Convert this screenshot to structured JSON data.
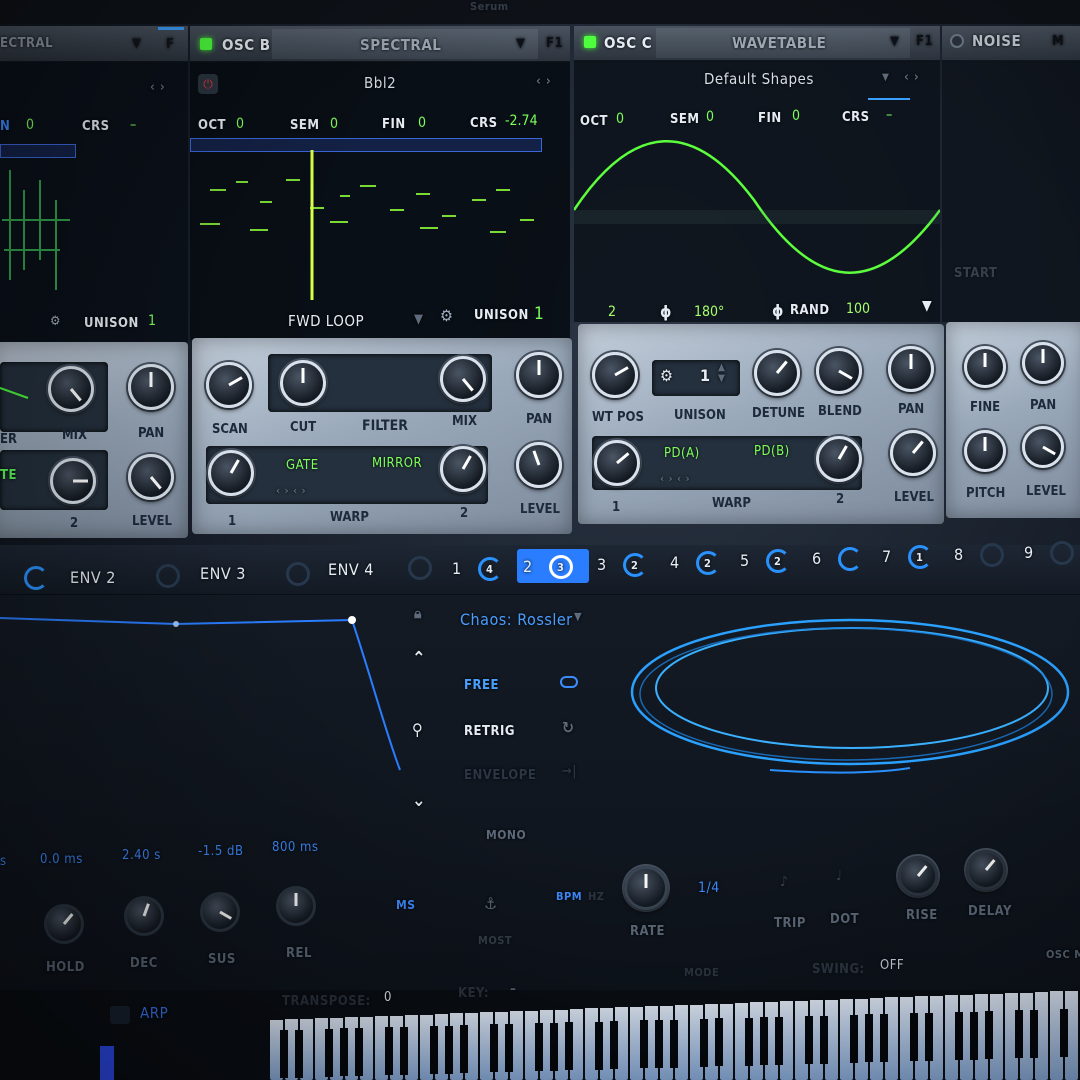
{
  "top_header": {
    "partial_title": "Serum",
    "sliver_right": "OSC"
  },
  "osc_a": {
    "type": "SPECTRAL",
    "fx_label": "F",
    "fin_label_partial": "N",
    "fin_value": "0",
    "crs_label": "CRS",
    "crs_value": "–",
    "unison_label": "UNISON",
    "unison_value": "1",
    "mix_label": "MIX",
    "pan_label": "PAN",
    "level_label": "LEVEL",
    "filter_label_partial": "ER",
    "warp_value": "2",
    "warp_mode_partial": "TE"
  },
  "osc_b": {
    "label": "OSC B",
    "type": "SPECTRAL",
    "fx_label": "F1",
    "preset": "Bbl2",
    "oct_label": "OCT",
    "oct_value": "0",
    "sem_label": "SEM",
    "sem_value": "0",
    "fin_label": "FIN",
    "fin_value": "0",
    "crs_label": "CRS",
    "crs_value": "-2.74",
    "loop_mode": "FWD LOOP",
    "unison_label": "UNISON",
    "unison_value": "1",
    "scan_label": "SCAN",
    "cut_label": "CUT",
    "filter_label": "FILTER",
    "mix_label": "MIX",
    "pan_label": "PAN",
    "level_label": "LEVEL",
    "warp_a": "GATE",
    "warp_b": "MIRROR",
    "warp_label": "WARP",
    "warp_min": "1",
    "warp_max": "2"
  },
  "osc_c": {
    "label": "OSC C",
    "type": "WAVETABLE",
    "fx_label": "F1",
    "preset": "Default Shapes",
    "oct_label": "OCT",
    "oct_value": "0",
    "sem_label": "SEM",
    "sem_value": "0",
    "fin_label": "FIN",
    "fin_value": "0",
    "crs_label": "CRS",
    "crs_value": "–",
    "unison_count": "2",
    "phase_value": "180°",
    "rand_label": "RAND",
    "rand_value": "100",
    "wtpos_label": "WT POS",
    "unison_label": "UNISON",
    "unison_value": "1",
    "detune_label": "DETUNE",
    "blend_label": "BLEND",
    "pan_label": "PAN",
    "level_label": "LEVEL",
    "warp_a": "PD(A)",
    "warp_b": "PD(B)",
    "warp_label": "WARP",
    "warp_min": "1",
    "warp_max": "2"
  },
  "noise": {
    "label": "NOISE",
    "m_label": "M",
    "fine_label": "FINE",
    "pan_label": "PAN",
    "pitch_label": "PITCH",
    "level_label": "LEVEL",
    "faded_label": "START"
  },
  "mod_tabs": {
    "env2": "ENV 2",
    "env3": "ENV 3",
    "env4": "ENV 4",
    "lfos": [
      {
        "num": "1",
        "badge": "4"
      },
      {
        "num": "2",
        "badge": "3"
      },
      {
        "num": "3",
        "badge": "2"
      },
      {
        "num": "4",
        "badge": "2"
      },
      {
        "num": "5",
        "badge": "2"
      },
      {
        "num": "6",
        "badge": ""
      },
      {
        "num": "7",
        "badge": "1"
      },
      {
        "num": "8",
        "badge": ""
      },
      {
        "num": "9",
        "badge": ""
      }
    ]
  },
  "envelope": {
    "values": {
      "attack_partial": "s",
      "hold": "0.0 ms",
      "decay": "2.40 s",
      "sustain": "-1.5 dB",
      "release": "800 ms"
    },
    "labels": {
      "hold": "HOLD",
      "decay": "DEC",
      "sustain": "SUS",
      "release": "REL"
    },
    "ms_label": "MS"
  },
  "lfo": {
    "preset": "Chaos: Rossler",
    "free": "FREE",
    "retrig": "RETRIG",
    "envelope": "ENVELOPE",
    "mono": "MONO",
    "bpm": "BPM",
    "bpm_after": "HZ",
    "rate_label": "RATE",
    "rate_value": "1/4",
    "trip": "TRIP",
    "dot": "DOT",
    "rise": "RISE",
    "delay": "DELAY",
    "swing_label": "SWING:",
    "swing_value": "OFF",
    "anchor_label": "MOST",
    "mode_label": "MODE"
  },
  "bottom": {
    "arp": "ARP",
    "transpose_label": "TRANSPOSE:",
    "transpose_value": "0",
    "key_label": "KEY:",
    "key_value": "–",
    "osc_label": "OSC M"
  },
  "colors": {
    "accent_blue": "#2a92ff",
    "accent_green": "#4dff3d",
    "panel": "#aab7c6"
  }
}
